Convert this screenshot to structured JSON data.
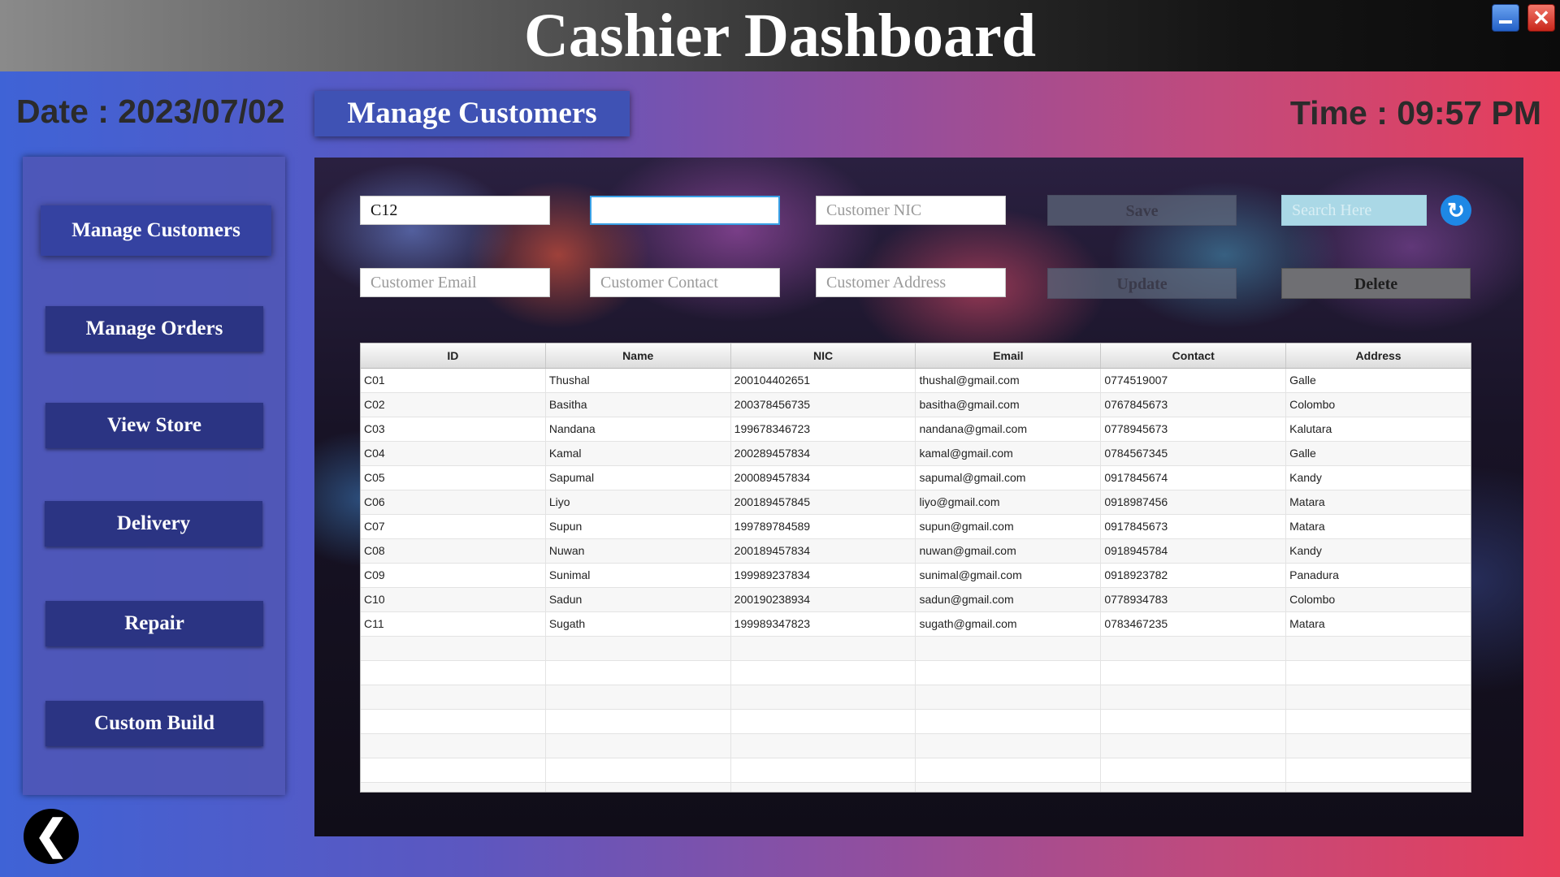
{
  "window": {
    "title": "Cashier Dashboard",
    "minimize_icon": "minimize-icon",
    "close_symbol": "✕"
  },
  "header": {
    "date_text": "Date : 2023/07/02",
    "time_text": "Time :   09:57 PM",
    "section_title": "Manage Customers"
  },
  "sidebar": {
    "items": [
      {
        "label": "Manage Customers"
      },
      {
        "label": "Manage Orders"
      },
      {
        "label": "View Store"
      },
      {
        "label": "Delivery"
      },
      {
        "label": "Repair"
      },
      {
        "label": "Custom Build"
      }
    ],
    "back_symbol": "❮"
  },
  "form": {
    "id_value": "C12",
    "name_value": "",
    "nic_placeholder": "Customer NIC",
    "email_placeholder": "Customer Email",
    "contact_placeholder": "Customer Contact",
    "address_placeholder": "Customer Address",
    "search_placeholder": "Search Here",
    "save_label": "Save",
    "update_label": "Update",
    "delete_label": "Delete",
    "refresh_symbol": "↻"
  },
  "table": {
    "columns": [
      "ID",
      "Name",
      "NIC",
      "Email",
      "Contact",
      "Address"
    ],
    "rows": [
      [
        "C01",
        "Thushal",
        "200104402651",
        "thushal@gmail.com",
        "0774519007",
        "Galle"
      ],
      [
        "C02",
        "Basitha",
        "200378456735",
        "basitha@gmail.com",
        "0767845673",
        "Colombo"
      ],
      [
        "C03",
        "Nandana",
        "199678346723",
        "nandana@gmail.com",
        "0778945673",
        "Kalutara"
      ],
      [
        "C04",
        "Kamal",
        "200289457834",
        "kamal@gmail.com",
        "0784567345",
        "Galle"
      ],
      [
        "C05",
        "Sapumal",
        "200089457834",
        "sapumal@gmail.com",
        "0917845674",
        "Kandy"
      ],
      [
        "C06",
        "Liyo",
        "200189457845",
        "liyo@gmail.com",
        "0918987456",
        "Matara"
      ],
      [
        "C07",
        "Supun",
        "199789784589",
        "supun@gmail.com",
        "0917845673",
        "Matara"
      ],
      [
        "C08",
        "Nuwan",
        "200189457834",
        "nuwan@gmail.com",
        "0918945784",
        "Kandy"
      ],
      [
        "C09",
        "Sunimal",
        "199989237834",
        "sunimal@gmail.com",
        "0918923782",
        "Panadura"
      ],
      [
        "C10",
        "Sadun",
        "200190238934",
        "sadun@gmail.com",
        "0778934783",
        "Colombo"
      ],
      [
        "C11",
        "Sugath",
        "199989347823",
        "sugath@gmail.com",
        "0783467235",
        "Matara"
      ]
    ],
    "empty_rows": 7
  },
  "colors": {
    "accent": "#3f52b4",
    "sidebar_button": "#2b3483",
    "refresh_button": "#1e88e5",
    "search_field": "#aad8e6"
  }
}
